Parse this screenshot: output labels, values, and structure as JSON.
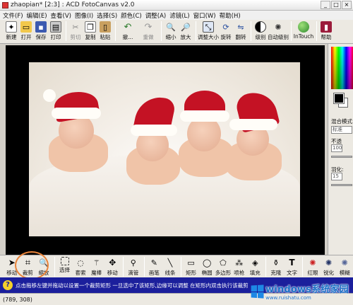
{
  "window": {
    "title": "zhaopian* [2:3] : ACD FotoCanvas v2.0"
  },
  "menu": [
    "文件(F)",
    "编辑(E)",
    "查看(V)",
    "图像(I)",
    "选择(S)",
    "颜色(C)",
    "调整(A)",
    "滤镜(L)",
    "窗口(W)",
    "帮助(H)"
  ],
  "toolbar": {
    "new": "新建",
    "open": "打开",
    "save": "保存",
    "print": "打印",
    "cut": "剪切",
    "copy": "复制",
    "paste": "粘贴",
    "undo": "撤...",
    "redo": "重做",
    "zoom_out": "缩小",
    "zoom_in": "放大",
    "resize": "调整大小",
    "rotate": "旋转",
    "flip": "翻转",
    "levels": "级别",
    "auto_levels": "自动级别",
    "intouch": "InTouch",
    "help": "帮助"
  },
  "right_panel": {
    "blend_label": "混合模式:",
    "blend_value": "标准",
    "opacity_label": "不透",
    "opacity_value": "100",
    "feather_label": "羽化:",
    "feather_value": "15"
  },
  "tools": {
    "move": "移动",
    "crop": "裁剪",
    "zoom": "缩放",
    "select": "选择",
    "lasso": "套索",
    "magic": "魔棒",
    "move2": "移动",
    "eyedropper": "滴管",
    "brush": "画笔",
    "line": "线条",
    "rect": "矩形",
    "ellipse": "椭圆",
    "polygon": "多边形",
    "spray": "喷枪",
    "fill": "填充",
    "clone": "克隆",
    "text": "文字",
    "redeye": "红眼",
    "sharpen": "锐化",
    "blur": "模糊"
  },
  "hint": "点击拖移左键并拖动以设置一个裁剪矩形  一旦选中了该矩形,边缘可以调整  在矩形内双击执行该裁剪",
  "status": {
    "coords": "(789, 308)"
  },
  "watermark": {
    "title": "windows系统家园",
    "url": "www.ruishatu.com"
  }
}
